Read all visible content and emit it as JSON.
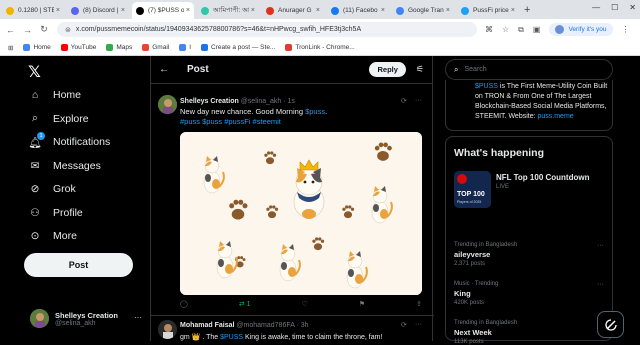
{
  "browser": {
    "tabs": [
      {
        "label": "0.1280 | STE",
        "icon_color": "#f0b400",
        "active": false
      },
      {
        "label": "(8) Discord |",
        "icon_color": "#5865f2",
        "active": false
      },
      {
        "label": "(7) $PUSS o",
        "icon_color": "#000000",
        "active": true
      },
      {
        "label": "আমিপাপী: আ",
        "icon_color": "#30c8a8",
        "active": false
      },
      {
        "label": "Anurager G",
        "icon_color": "#e0301e",
        "active": false
      },
      {
        "label": "(11) Facebo",
        "icon_color": "#1877f2",
        "active": false
      },
      {
        "label": "Google Tran",
        "icon_color": "#4285f4",
        "active": false
      },
      {
        "label": "PussFi price",
        "icon_color": "#1da1f2",
        "active": false
      }
    ],
    "url": "x.com/pussmemecoin/status/1940934362578800786?s=46&t=nHPwcg_swfih_HFE3tj3ch5A",
    "verify_label": "Verify it's you",
    "bookmarks": [
      {
        "label": "Home",
        "color": "#4285f4"
      },
      {
        "label": "YouTube",
        "color": "#ff0000"
      },
      {
        "label": "Maps",
        "color": "#34a853"
      },
      {
        "label": "Gmail",
        "color": "#ea4335"
      },
      {
        "label": "I",
        "color": "#4285f4"
      },
      {
        "label": "Create a post — Ste...",
        "color": "#1a73e8"
      },
      {
        "label": "TronLink - Chrome...",
        "color": "#e53935"
      }
    ]
  },
  "nav": {
    "items": [
      {
        "label": "Home",
        "icon": "home-icon"
      },
      {
        "label": "Explore",
        "icon": "search-icon"
      },
      {
        "label": "Notifications",
        "icon": "bell-icon",
        "badge": "1"
      },
      {
        "label": "Messages",
        "icon": "mail-icon"
      },
      {
        "label": "Grok",
        "icon": "grok-icon"
      },
      {
        "label": "Profile",
        "icon": "person-icon"
      },
      {
        "label": "More",
        "icon": "more-circle-icon"
      }
    ],
    "post_label": "Post",
    "account": {
      "name": "Shelleys Creation",
      "handle": "@selina_akh"
    }
  },
  "center": {
    "title": "Post",
    "reply_label": "Reply",
    "tweet": {
      "name": "Shelleys Creation",
      "handle": "@selina_akh · 1s",
      "text_plain": "New day new chance. Good Morning ",
      "text_tag": "$puss",
      "text_end": ".",
      "hashtags": "#puss $puss #pussFi #steemit",
      "retweets": "1"
    },
    "tweet2": {
      "name": "Mohamad Faisal",
      "handle": "@mohamad786FA · 3h",
      "text_a": "gm 👑 . The ",
      "text_tag": "$PUSS",
      "text_b": " King is awake, time to claim the throne, fam!"
    }
  },
  "right": {
    "search_placeholder": "Search",
    "promo_tag": "$PUSS",
    "promo_text": " is The First Meme-Utility Coin Built on TRON & From One of The Largest Blockchain-Based Social Media Platforms, STEEMIT. Website: ",
    "promo_link": "puss.meme",
    "trends_title": "What's happening",
    "featured": {
      "title": "NFL Top 100 Countdown",
      "status": "LIVE",
      "thumb_top": "TOP 100",
      "thumb_sub": "Players of 2025"
    },
    "trends": [
      {
        "category": "Trending in Bangladesh",
        "name": "aileyverse",
        "count": "2,371 posts"
      },
      {
        "category": "Music · Trending",
        "name": "King",
        "count": "420K posts"
      },
      {
        "category": "Trending in Bangladesh",
        "name": "Next Week",
        "count": "113K posts"
      }
    ]
  }
}
